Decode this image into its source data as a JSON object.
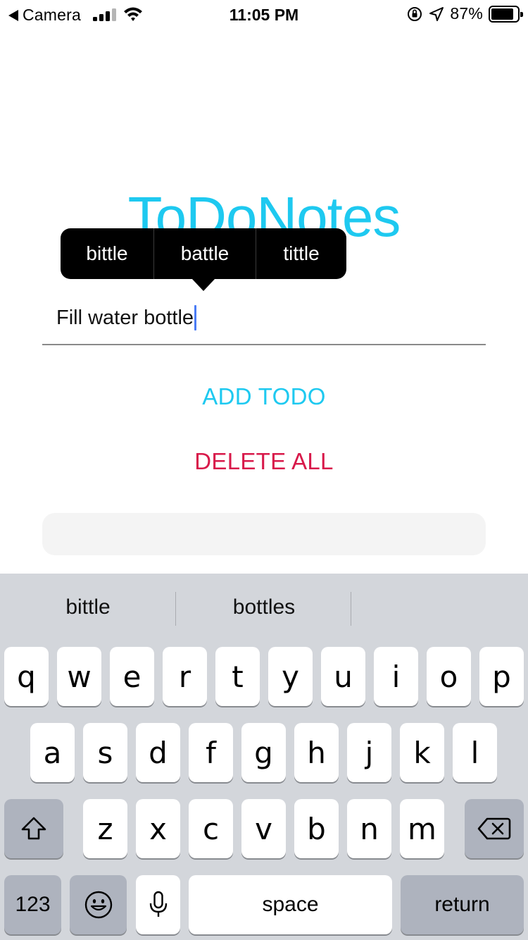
{
  "status_bar": {
    "back_label": "Camera",
    "time": "11:05 PM",
    "battery_percent": "87%",
    "battery_level": 0.87
  },
  "app": {
    "title": "ToDoNotes",
    "input": {
      "value": "Fill water bottle"
    },
    "spell_suggestions": [
      "bittle",
      "battle",
      "tittle"
    ],
    "add_button": "ADD TODO",
    "delete_button": "DELETE ALL",
    "colors": {
      "accent": "#1ec9f0",
      "danger": "#d8194a"
    }
  },
  "keyboard": {
    "predictions": [
      "bittle",
      "bottles",
      ""
    ],
    "row1": [
      "q",
      "w",
      "e",
      "r",
      "t",
      "y",
      "u",
      "i",
      "o",
      "p"
    ],
    "row2": [
      "a",
      "s",
      "d",
      "f",
      "g",
      "h",
      "j",
      "k",
      "l"
    ],
    "row3": [
      "z",
      "x",
      "c",
      "v",
      "b",
      "n",
      "m"
    ],
    "numbers_key": "123",
    "space_key": "space",
    "return_key": "return",
    "icons": [
      "shift-icon",
      "backspace-icon",
      "emoji-icon",
      "microphone-icon"
    ]
  }
}
